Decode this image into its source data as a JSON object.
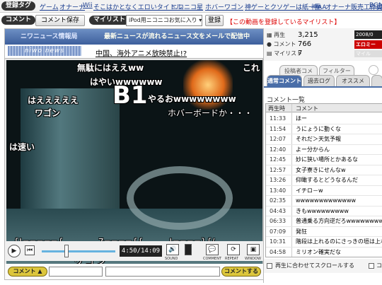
{
  "tags": {
    "label": "登録タグ",
    "items": [
      "ゲーム",
      "オナーナ",
      "Wii",
      "そこはかとなくエロいタイトル",
      "ニコニコ星",
      "ホバーワゴン",
      "神ゲーとクソゲーは紙一重",
      "神AA",
      "オナーナ販売工作員動画",
      "BGM"
    ]
  },
  "commentbar": {
    "comment_label": "コメント",
    "save_button": "コメント保存",
    "mylist_label": "マイリスト",
    "mylist_select": "iPod用ニコニコお気に入り",
    "register_button": "登録",
    "mylist_link": "【この動画を登録しているマイリスト】"
  },
  "player": {
    "marquee_label": "ニワニュース情報局",
    "marquee_text": "最新ニュースが流れるニュース文をメールで配信中",
    "news_logo": "niwo news",
    "headline": "中国、海外アニメ放映禁止!?",
    "time": "4:50/14:09",
    "control_labels": {
      "sound": "SOUND",
      "comment": "COMMENT",
      "repeat": "REPEAT",
      "window": "WINDOW"
    },
    "comment_button": "コメント",
    "submit_button": "コメントする"
  },
  "overlay_comments": [
    {
      "text": "無駄にはええww"
    },
    {
      "text": "これ"
    },
    {
      "text": "はやいwwwwww"
    },
    {
      "text": "B1"
    },
    {
      "text": "はえええええ"
    },
    {
      "text": "ワゴン"
    },
    {
      "text": "やるおwwwwwwww"
    },
    {
      "text": "ホバーボードか・・・"
    },
    {
      "text": "は速い"
    },
    {
      "text": "ワ ゴ ン"
    },
    {
      "text": "{!====={"
    },
    {
      "text": "7===={{"
    },
    {
      "text": "!====}{/"
    }
  ],
  "stats": {
    "views_label": "再生",
    "views": "3,215",
    "comments_label": "コメント",
    "comments": "766",
    "mylist_label": "マイリスト",
    "mylist": "7",
    "date": "2008/0",
    "ero_badge": "エロミー",
    "mylist_badge": "マイル"
  },
  "panel": {
    "tabs_top": [
      "投稿者コメ",
      "フィルター"
    ],
    "tabs": [
      "通常コメント",
      "過去ログ",
      "オススメ"
    ],
    "list_title": "コメント一覧",
    "header_time": "再生時",
    "header_comment": "コメント",
    "rows": [
      {
        "time": "11:33",
        "comment": "ほー"
      },
      {
        "time": "11:54",
        "comment": "うにょうに動くな"
      },
      {
        "time": "12:07",
        "comment": "それだ＞天気予報"
      },
      {
        "time": "12:40",
        "comment": "よー分からん"
      },
      {
        "time": "12:45",
        "comment": "妙に狭い場所とかあるな"
      },
      {
        "time": "12:57",
        "comment": "女子寮きにせんなw"
      },
      {
        "time": "13:26",
        "comment": "仰瞰するとどうなるんだ"
      },
      {
        "time": "13:40",
        "comment": "イチロ－w"
      },
      {
        "time": "02:35",
        "comment": "wwwwwwwwwwwww"
      },
      {
        "time": "04:43",
        "comment": "きもwwwwwwwww"
      },
      {
        "time": "06:33",
        "comment": "普通乗る方向逆だろwwwwwwww"
      },
      {
        "time": "07:09",
        "comment": "発狂"
      },
      {
        "time": "10:31",
        "comment": "階段は上れるのにさっきの垣は上れな"
      },
      {
        "time": "04:58",
        "comment": "ミリオン確実だな"
      }
    ],
    "scroll_label": "再生に合わせてスクロールする",
    "extra_label": "コ"
  }
}
